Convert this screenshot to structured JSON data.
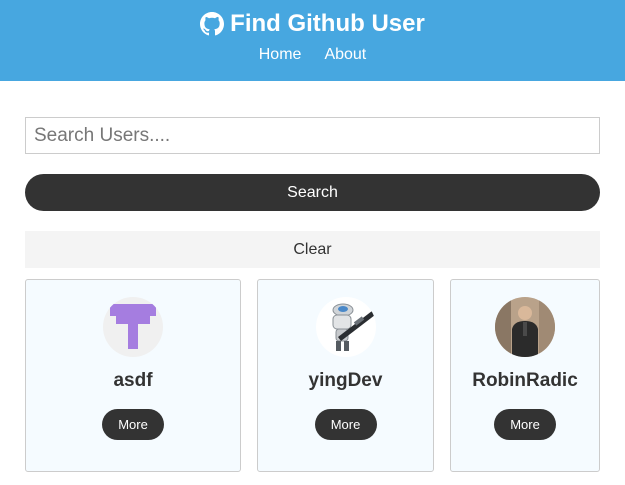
{
  "navbar": {
    "title": "Find Github User",
    "icon": "github-icon",
    "links": [
      {
        "label": "Home"
      },
      {
        "label": "About"
      }
    ]
  },
  "search": {
    "placeholder": "Search Users....",
    "value": "",
    "button_label": "Search",
    "clear_label": "Clear"
  },
  "users": [
    {
      "login": "asdf",
      "avatar": "identicon-avatar",
      "more_label": "More"
    },
    {
      "login": "yingDev",
      "avatar": "robot-avatar",
      "more_label": "More"
    },
    {
      "login": "RobinRadic",
      "avatar": "person-photo-avatar",
      "more_label": "More"
    }
  ],
  "colors": {
    "navbar": "#47a7e0",
    "dark": "#333333",
    "light": "#f4f4f4",
    "card_bg": "#f5fbff"
  }
}
